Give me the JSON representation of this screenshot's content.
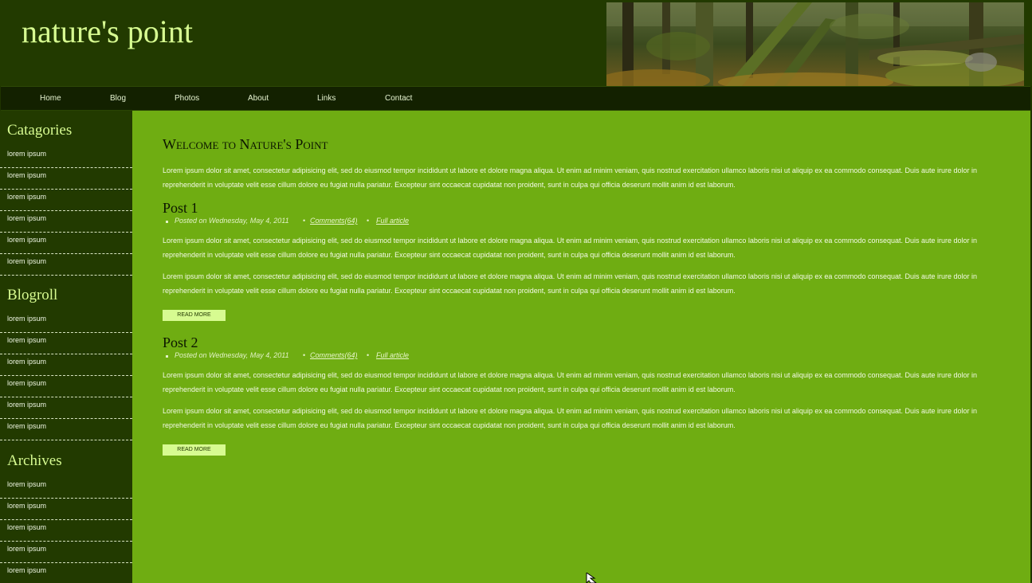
{
  "header": {
    "site_title": "nature's point"
  },
  "nav": {
    "items": [
      "Home",
      "Blog",
      "Photos",
      "About",
      "Links",
      "Contact"
    ]
  },
  "sidebar": {
    "categories": {
      "heading": "Catagories",
      "links": [
        "lorem ipsum",
        "lorem ipsum",
        "lorem ipsum",
        "lorem ipsum",
        "lorem ipsum",
        "lorem ipsum"
      ]
    },
    "blogroll": {
      "heading": "Blogroll",
      "links": [
        "lorem ipsum",
        "lorem ipsum",
        "lorem ipsum",
        "lorem ipsum",
        "lorem ipsum",
        "lorem ipsum"
      ]
    },
    "archives": {
      "heading": "Archives",
      "links": [
        "lorem ipsum",
        "lorem ipsum",
        "lorem ipsum",
        "lorem ipsum",
        "lorem ipsum"
      ]
    }
  },
  "main": {
    "welcome_title": "Welcome to Nature's Point",
    "intro": "Lorem ipsum dolor sit amet, consectetur adipisicing elit, sed do eiusmod tempor incididunt ut labore et dolore magna aliqua. Ut enim ad minim veniam, quis nostrud exercitation ullamco laboris nisi ut aliquip ex ea commodo consequat. Duis aute irure dolor in reprehenderit in voluptate velit esse cillum dolore eu fugiat nulla pariatur. Excepteur sint occaecat cupidatat non proident, sunt in culpa qui officia deserunt mollit anim id est laborum.",
    "posts": [
      {
        "title": "Post 1",
        "posted": "Posted on Wednesday, May 4, 2011",
        "comments": "Comments(64)",
        "full_article": "Full article",
        "paragraphs": [
          "Lorem ipsum dolor sit amet, consectetur adipisicing elit, sed do eiusmod tempor incididunt ut labore et dolore magna aliqua. Ut enim ad minim veniam, quis nostrud exercitation ullamco laboris nisi ut aliquip ex ea commodo consequat. Duis aute irure dolor in reprehenderit in voluptate velit esse cillum dolore eu fugiat nulla pariatur. Excepteur sint occaecat cupidatat non proident, sunt in culpa qui officia deserunt mollit anim id est laborum.",
          "Lorem ipsum dolor sit amet, consectetur adipisicing elit, sed do eiusmod tempor incididunt ut labore et dolore magna aliqua. Ut enim ad minim veniam, quis nostrud exercitation ullamco laboris nisi ut aliquip ex ea commodo consequat. Duis aute irure dolor in reprehenderit in voluptate velit esse cillum dolore eu fugiat nulla pariatur. Excepteur sint occaecat cupidatat non proident, sunt in culpa qui officia deserunt mollit anim id est laborum."
        ],
        "read_more": "READ MORE"
      },
      {
        "title": "Post 2",
        "posted": "Posted on Wednesday, May 4, 2011",
        "comments": "Comments(64)",
        "full_article": "Full article",
        "paragraphs": [
          "Lorem ipsum dolor sit amet, consectetur adipisicing elit, sed do eiusmod tempor incididunt ut labore et dolore magna aliqua. Ut enim ad minim veniam, quis nostrud exercitation ullamco laboris nisi ut aliquip ex ea commodo consequat. Duis aute irure dolor in reprehenderit in voluptate velit esse cillum dolore eu fugiat nulla pariatur. Excepteur sint occaecat cupidatat non proident, sunt in culpa qui officia deserunt mollit anim id est laborum.",
          "Lorem ipsum dolor sit amet, consectetur adipisicing elit, sed do eiusmod tempor incididunt ut labore et dolore magna aliqua. Ut enim ad minim veniam, quis nostrud exercitation ullamco laboris nisi ut aliquip ex ea commodo consequat. Duis aute irure dolor in reprehenderit in voluptate velit esse cillum dolore eu fugiat nulla pariatur. Excepteur sint occaecat cupidatat non proident, sunt in culpa qui officia deserunt mollit anim id est laborum."
        ],
        "read_more": "READ MORE"
      }
    ]
  },
  "colors": {
    "header_bg": "#223a00",
    "nav_bg": "#132100",
    "content_bg": "#6fad12",
    "accent": "#d7fb91",
    "heading_dark": "#0c1600"
  },
  "icons": {
    "banner": "forest-banner-image",
    "cursor": "mouse-pointer-icon"
  }
}
